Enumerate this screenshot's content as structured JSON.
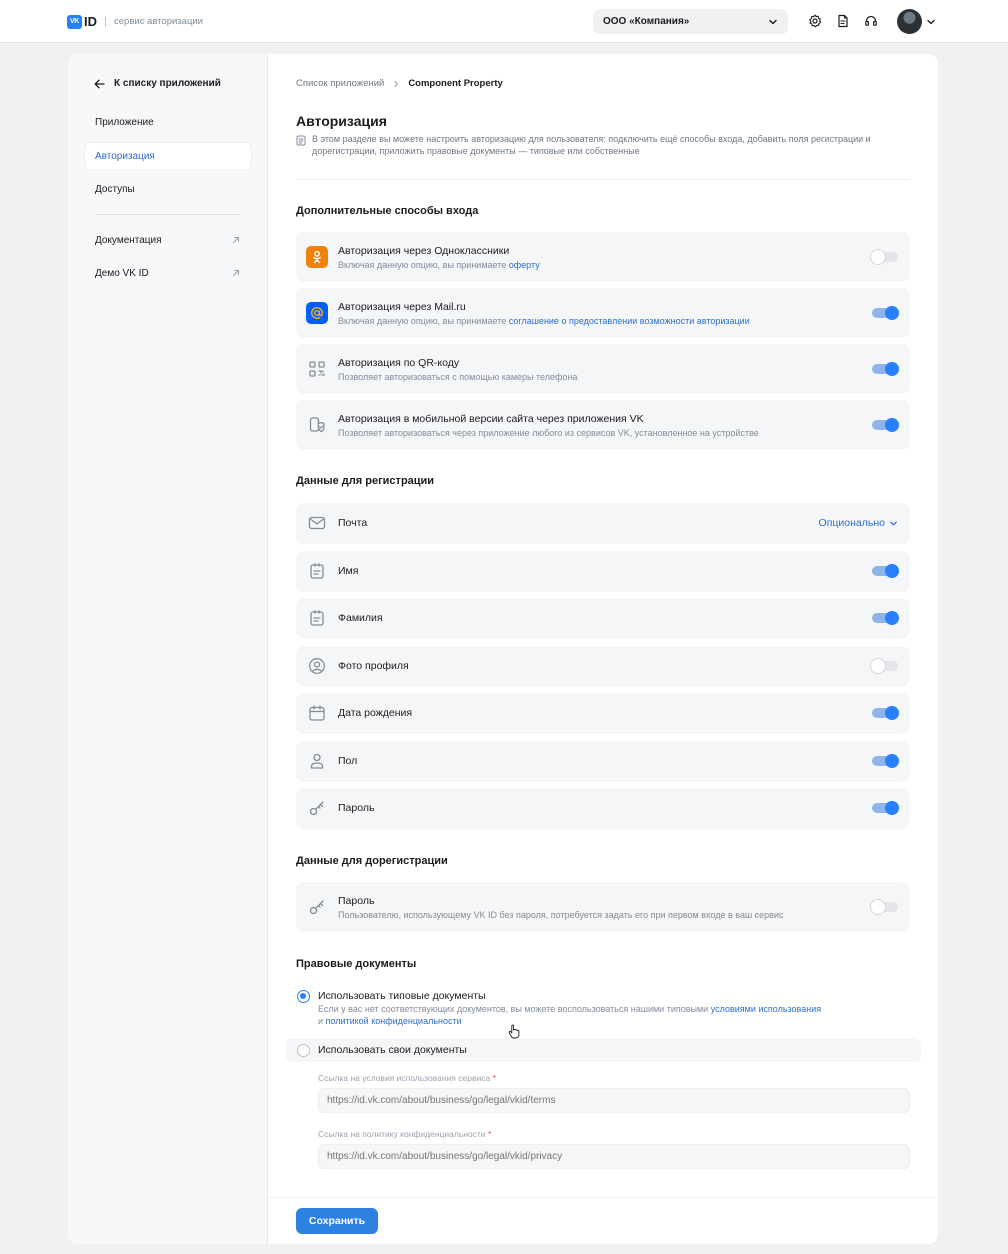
{
  "header": {
    "logo_badge": "VK",
    "logo_id": "ID",
    "logo_subtitle": "сервис авторизации",
    "company_select": "ООО «Компания»"
  },
  "sidebar": {
    "back_label": "К списку приложений",
    "items": [
      {
        "label": "Приложение"
      },
      {
        "label": "Авторизация"
      },
      {
        "label": "Доступы"
      }
    ],
    "links": [
      {
        "label": "Документация"
      },
      {
        "label": "Демо VK ID"
      }
    ]
  },
  "breadcrumb": {
    "parent": "Список приложений",
    "current": "Component Property"
  },
  "page": {
    "title": "Авторизация",
    "description": "В этом разделе вы можете настроить авторизацию для пользователя: подключить ещё способы входа, добавить поля регистрации и дорегистрации, приложить правовые документы — типовые или собственные"
  },
  "login_methods": {
    "heading": "Дополнительные способы входа",
    "items": [
      {
        "title": "Авторизация через Одноклассники",
        "sub_prefix": "Включая данную опцию, вы принимаете ",
        "sub_link": "оферту",
        "enabled": false
      },
      {
        "title": "Авторизация через Mail.ru",
        "sub_prefix": "Включая данную опцию, вы принимаете ",
        "sub_link": "соглашение о предоставлении возможности авторизации",
        "enabled": true
      },
      {
        "title": "Авторизация по QR-коду",
        "sub_prefix": "Позволяет авторизоваться с помощью камеры телефона",
        "sub_link": "",
        "enabled": true
      },
      {
        "title": "Авторизация в мобильной версии сайта через приложения VK",
        "sub_prefix": "Позволяет авторизоваться через приложение любого из сервисов VK, установленное на устройстве",
        "sub_link": "",
        "enabled": true
      }
    ]
  },
  "registration": {
    "heading": "Данные для регистрации",
    "email": {
      "label": "Почта",
      "option": "Опционально"
    },
    "items": [
      {
        "label": "Имя",
        "enabled": true
      },
      {
        "label": "Фамилия",
        "enabled": true
      },
      {
        "label": "Фото профиля",
        "enabled": false
      },
      {
        "label": "Дата рождения",
        "enabled": true
      },
      {
        "label": "Пол",
        "enabled": true
      },
      {
        "label": "Пароль",
        "enabled": true
      }
    ]
  },
  "pre_registration": {
    "heading": "Данные для дорегистрации",
    "title": "Пароль",
    "sub": "Пользователю, использующему VK ID без пароля, потребуется задать его при первом входе в ваш сервис",
    "enabled": false
  },
  "legal": {
    "heading": "Правовые документы",
    "standard_label": "Использовать типовые документы",
    "standard_sub_1": "Если у вас нет соответствующих документов, вы можете воспользоваться нашими типовыми ",
    "standard_link_1": "условиями использования",
    "standard_sub_2": "и ",
    "standard_link_2": "политикой конфиденциальности",
    "own_label": "Использовать свои документы",
    "terms_label": "Ссылка на условия использования сервиса",
    "terms_placeholder": "https://id.vk.com/about/business/go/legal/vkid/terms",
    "privacy_label": "Ссылка на политику конфиденциальности",
    "privacy_placeholder": "https://id.vk.com/about/business/go/legal/vkid/privacy",
    "required_mark": "*"
  },
  "footer": {
    "save_label": "Сохранить"
  },
  "colors": {
    "accent": "#2780ff",
    "link": "#2d6ecf",
    "ok_brand": "#ee8208",
    "mail_brand": "#005ff9"
  }
}
